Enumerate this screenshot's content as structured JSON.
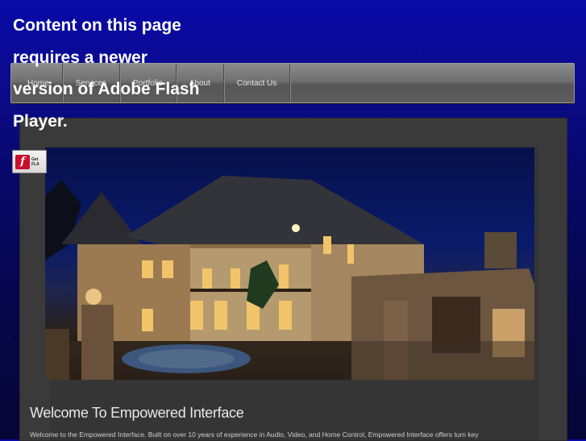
{
  "flash_notice": {
    "message": "Content on this page requires a newer version of Adobe Flash Player.",
    "badge_line1": "Get",
    "badge_line2": "FLA"
  },
  "nav": {
    "items": [
      {
        "label": "Home"
      },
      {
        "label": "Services"
      },
      {
        "label": "Portfolio"
      },
      {
        "label": "About"
      },
      {
        "label": "Contact Us"
      }
    ]
  },
  "main": {
    "title": "Welcome To Empowered Interface",
    "intro": "Welcome to the Empowered Interface.  Built on over 10 years of experience in Audio, Video, and Home Control, Empowered Interface offers turn key"
  }
}
